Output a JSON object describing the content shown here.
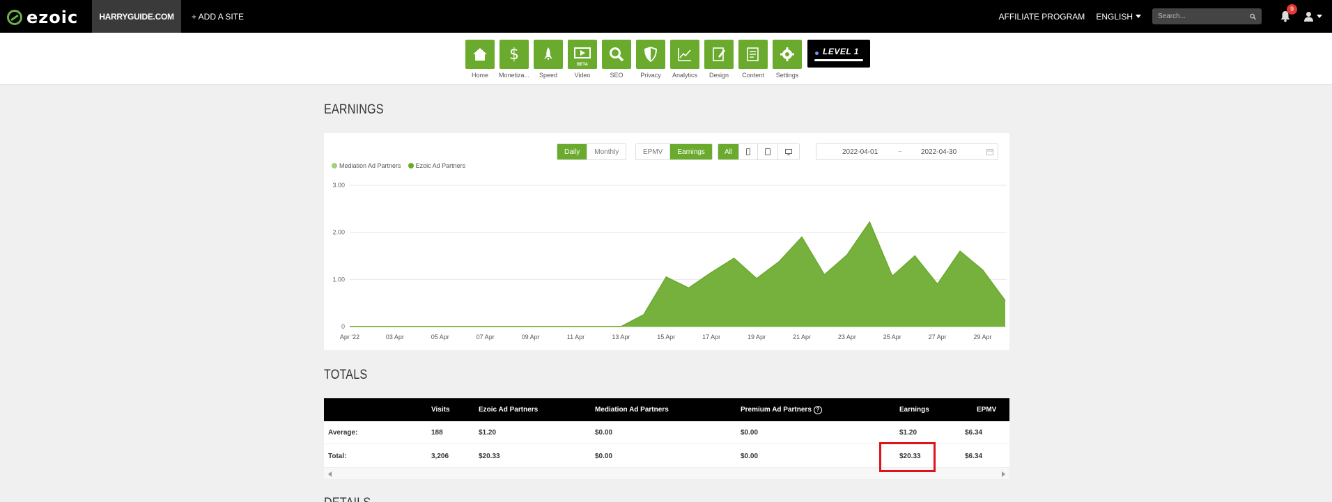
{
  "header": {
    "logo": "ezoic",
    "site": "HARRYGUIDE.COM",
    "add_site": "+ ADD A SITE",
    "affiliate": "AFFILIATE PROGRAM",
    "language": "ENGLISH",
    "search_placeholder": "Search...",
    "notifications": "9",
    "icons": [
      "search-icon",
      "bell-icon",
      "user-icon",
      "chevron-down-icon"
    ]
  },
  "tools": [
    {
      "label": "Home",
      "icon": "home-icon"
    },
    {
      "label": "Monetiza...",
      "icon": "dollar-icon"
    },
    {
      "label": "Speed",
      "icon": "rocket-icon"
    },
    {
      "label": "Video",
      "icon": "video-icon",
      "badge": "BETA"
    },
    {
      "label": "SEO",
      "icon": "magnifier-icon"
    },
    {
      "label": "Privacy",
      "icon": "shield-icon"
    },
    {
      "label": "Analytics",
      "icon": "line-chart-icon"
    },
    {
      "label": "Design",
      "icon": "design-icon"
    },
    {
      "label": "Content",
      "icon": "document-icon"
    },
    {
      "label": "Settings",
      "icon": "gear-icon"
    }
  ],
  "level": {
    "label": "LEVEL 1",
    "progress": 0.05
  },
  "earnings": {
    "title": "EARNINGS",
    "period_buttons": [
      "Daily",
      "Monthly"
    ],
    "period_active": "Daily",
    "metric_buttons": [
      "EPMV",
      "Earnings"
    ],
    "metric_active": "Earnings",
    "device_buttons": [
      "All",
      "mobile-icon",
      "tablet-icon",
      "desktop-icon"
    ],
    "device_active": "All",
    "date_start": "2022-04-01",
    "date_sep": "~",
    "date_end": "2022-04-30"
  },
  "chart_data": {
    "type": "area",
    "title": "",
    "xlabel": "",
    "ylabel": "",
    "ylim": [
      0,
      3
    ],
    "y_ticks": [
      "0",
      "1.00",
      "2.00",
      "3.00"
    ],
    "x_ticks": [
      "Apr '22",
      "03 Apr",
      "05 Apr",
      "07 Apr",
      "09 Apr",
      "11 Apr",
      "13 Apr",
      "15 Apr",
      "17 Apr",
      "19 Apr",
      "21 Apr",
      "23 Apr",
      "25 Apr",
      "27 Apr",
      "29 Apr"
    ],
    "categories": [
      "01 Apr",
      "02 Apr",
      "03 Apr",
      "04 Apr",
      "05 Apr",
      "06 Apr",
      "07 Apr",
      "08 Apr",
      "09 Apr",
      "10 Apr",
      "11 Apr",
      "12 Apr",
      "13 Apr",
      "14 Apr",
      "15 Apr",
      "16 Apr",
      "17 Apr",
      "18 Apr",
      "19 Apr",
      "20 Apr",
      "21 Apr",
      "22 Apr",
      "23 Apr",
      "24 Apr",
      "25 Apr",
      "26 Apr",
      "27 Apr",
      "28 Apr",
      "29 Apr",
      "30 Apr"
    ],
    "series": [
      {
        "name": "Mediation Ad Partners",
        "color": "#9fd07c",
        "values": [
          0,
          0,
          0,
          0,
          0,
          0,
          0,
          0,
          0,
          0,
          0,
          0,
          0,
          0,
          0,
          0,
          0,
          0,
          0,
          0,
          0,
          0,
          0,
          0,
          0,
          0,
          0,
          0,
          0,
          0
        ]
      },
      {
        "name": "Ezoic Ad Partners",
        "color": "#6aaa2d",
        "values": [
          0,
          0,
          0,
          0,
          0,
          0,
          0,
          0,
          0,
          0,
          0,
          0,
          0,
          0.25,
          1.05,
          0.82,
          1.15,
          1.45,
          1.02,
          1.38,
          1.9,
          1.1,
          1.52,
          2.22,
          1.07,
          1.5,
          0.9,
          1.6,
          1.2,
          0.55
        ]
      }
    ],
    "grid": true,
    "legend": "top-left"
  },
  "totals": {
    "title": "TOTALS",
    "columns": [
      "",
      "Visits",
      "Ezoic Ad Partners",
      "Mediation Ad Partners",
      "Premium Ad Partners",
      "Earnings",
      "EPMV"
    ],
    "rows": [
      [
        "Average:",
        "188",
        "$1.20",
        "$0.00",
        "$0.00",
        "$1.20",
        "$6.34"
      ],
      [
        "Total:",
        "3,206",
        "$20.33",
        "$0.00",
        "$0.00",
        "$20.33",
        "$6.34"
      ]
    ],
    "highlight_color": "#e0121b"
  },
  "details": {
    "title": "DETAILS"
  }
}
